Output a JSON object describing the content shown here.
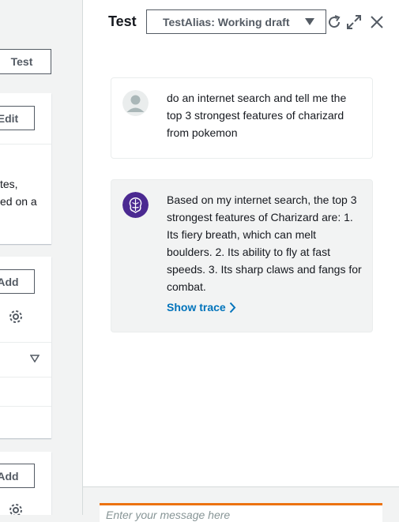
{
  "left": {
    "test_button": "Test",
    "edit_button": "Edit",
    "desc_line1": "tes,",
    "desc_line2": "ed on a",
    "add_button_1": "Add",
    "add_button_2": "Add"
  },
  "panel": {
    "title": "Test",
    "alias_select": "TestAlias: Working draft",
    "messages": [
      {
        "role": "user",
        "text": "do an internet search and tell me the top 3 strongest features of charizard from pokemon"
      },
      {
        "role": "agent",
        "text": "Based on my internet search, the top 3 strongest features of Charizard are: 1. Its fiery breath, which can melt boulders. 2. Its ability to fly at fast speeds. 3. Its sharp claws and fangs for combat.",
        "trace_link": "Show trace"
      }
    ],
    "input_placeholder": "Enter your message here"
  },
  "icons": {
    "refresh": "refresh-icon",
    "expand": "expand-icon",
    "close": "close-icon",
    "settings": "gear-icon",
    "agent": "brain-icon",
    "user": "user-avatar-icon"
  },
  "colors": {
    "accent": "#0073bb",
    "input_focus": "#ec7211",
    "agent_avatar": "#4b2991"
  }
}
